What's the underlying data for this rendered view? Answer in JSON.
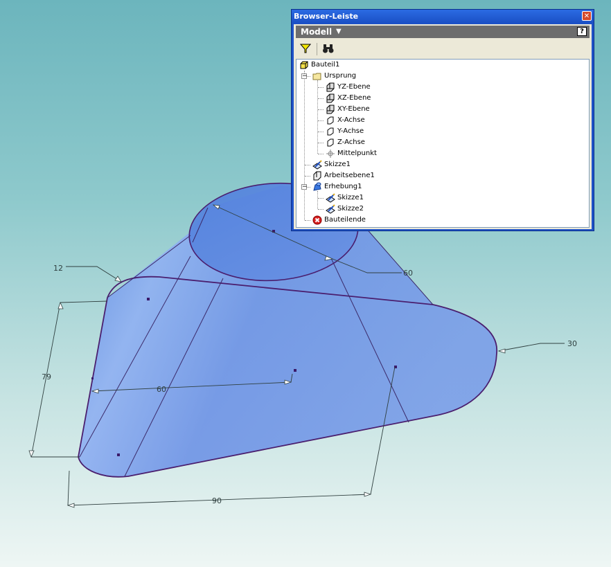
{
  "viewport": {
    "dimensions": {
      "d12": "12",
      "d79": "79",
      "d60_left": "60",
      "d60_top": "60",
      "d30": "30",
      "d90": "90"
    },
    "colors": {
      "body_fill": "#6e98e8",
      "edge": "#4a1e6e",
      "dimension": "#2f3f3f"
    }
  },
  "browser": {
    "title": "Browser-Leiste",
    "close_label": "✕",
    "header_label": "Modell",
    "header_dropdown": "▼",
    "help_label": "?",
    "toolbar": {
      "filter_icon": "filter-icon",
      "find_icon": "binoculars-icon"
    },
    "tree": [
      {
        "label": "Bauteil1",
        "icon": "part-icon"
      },
      {
        "label": "Ursprung",
        "icon": "folder-icon"
      },
      {
        "label": "YZ-Ebene",
        "icon": "plane-icon"
      },
      {
        "label": "XZ-Ebene",
        "icon": "plane-icon"
      },
      {
        "label": "XY-Ebene",
        "icon": "plane-icon"
      },
      {
        "label": "X-Achse",
        "icon": "axis-icon"
      },
      {
        "label": "Y-Achse",
        "icon": "axis-icon"
      },
      {
        "label": "Z-Achse",
        "icon": "axis-icon"
      },
      {
        "label": "Mittelpunkt",
        "icon": "point-icon"
      },
      {
        "label": "Skizze1",
        "icon": "sketch-icon"
      },
      {
        "label": "Arbeitsebene1",
        "icon": "workplane-icon"
      },
      {
        "label": "Erhebung1",
        "icon": "loft-icon"
      },
      {
        "label": "Skizze1",
        "icon": "sketch-icon"
      },
      {
        "label": "Skizze2",
        "icon": "sketch-icon"
      },
      {
        "label": "Bauteilende",
        "icon": "end-of-part-icon"
      }
    ]
  }
}
